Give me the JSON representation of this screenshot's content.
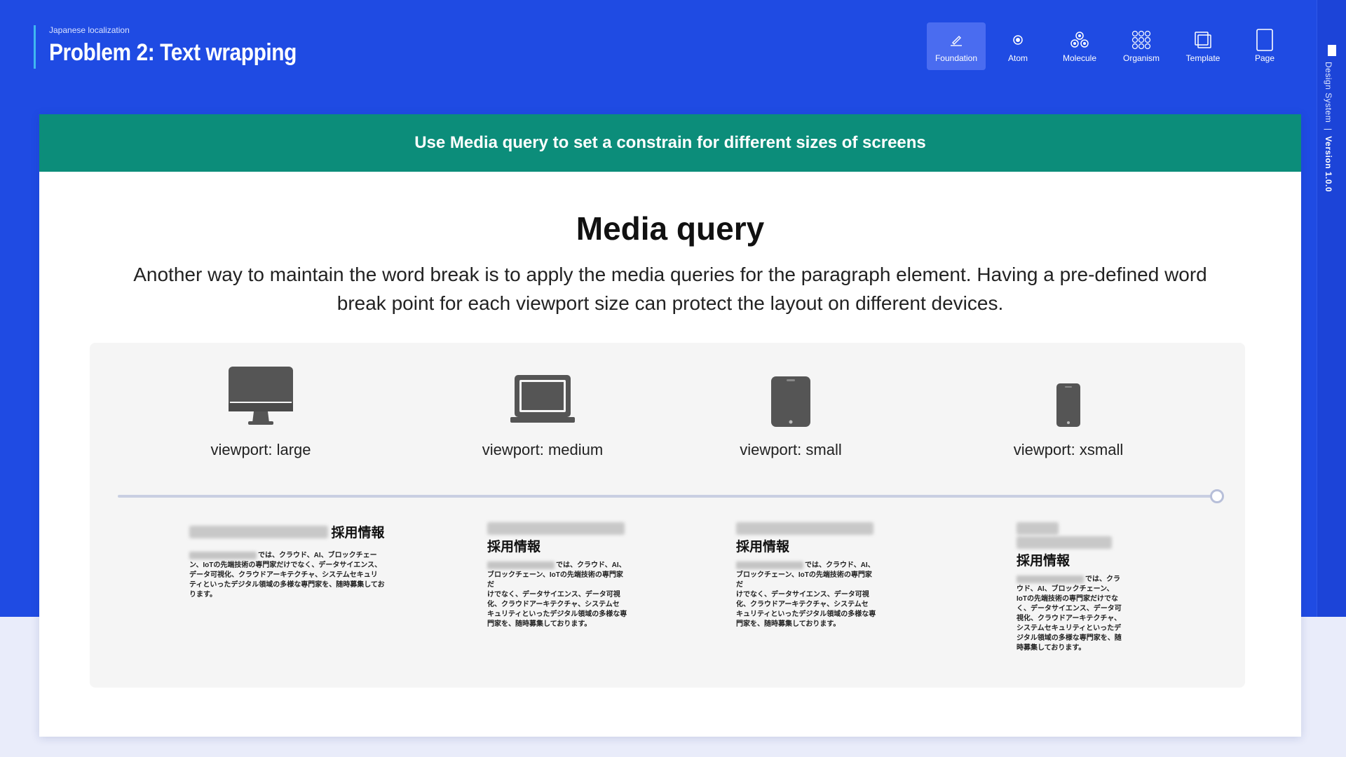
{
  "header": {
    "eyebrow": "Japanese localization",
    "title": "Problem 2: Text wrapping"
  },
  "nav": {
    "items": [
      {
        "label": "Foundation",
        "icon": "pencil-icon",
        "active": true
      },
      {
        "label": "Atom",
        "icon": "atom-icon",
        "active": false
      },
      {
        "label": "Molecule",
        "icon": "molecule-icon",
        "active": false
      },
      {
        "label": "Organism",
        "icon": "organism-icon",
        "active": false
      },
      {
        "label": "Template",
        "icon": "template-icon",
        "active": false
      },
      {
        "label": "Page",
        "icon": "page-icon",
        "active": false
      }
    ]
  },
  "siderail": {
    "label": "Design System",
    "separator": "|",
    "version": "Version 1.0.0"
  },
  "banner": {
    "text": "Use Media query to set a constrain for different sizes of screens"
  },
  "section": {
    "heading": "Media query",
    "lead": "Another way to maintain the word break is to apply the media queries for the paragraph element. Having a pre-defined word break point for each viewport size can protect the layout on different devices."
  },
  "viewports": [
    {
      "label": "viewport: large",
      "icon": "desktop-monitor-icon"
    },
    {
      "label": "viewport: medium",
      "icon": "laptop-icon"
    },
    {
      "label": "viewport: small",
      "icon": "tablet-icon"
    },
    {
      "label": "viewport: xsmall",
      "icon": "smartphone-icon"
    }
  ],
  "samples": {
    "title": "採用情報",
    "body_prefix": "では、",
    "body_lines_large": [
      "では、クラウド、AI、ブロックチェー",
      "ン、IoTの先端技術の専門家だけでなく、データサイエンス、",
      "データ可視化、クラウドアーキテクチャ、システムセキュリ",
      "ティといったデジタル領域の多様な専門家を、随時募集してお",
      "ります。"
    ],
    "body_lines_medium": [
      "では、クラウド、AI、",
      "ブロックチェーン、IoTの先端技術の専門家だ",
      "けでなく、データサイエンス、データ可視",
      "化、クラウドアーキテクチャ、システムセ",
      "キュリティといったデジタル領域の多様な専",
      "門家を、随時募集しております。"
    ],
    "body_lines_small": [
      "では、クラウド、AI、",
      "ブロックチェーン、IoTの先端技術の専門家だ",
      "けでなく、データサイエンス、データ可視",
      "化、クラウドアーキテクチャ、システムセ",
      "キュリティといったデジタル領域の多様な専",
      "門家を、随時募集しております。"
    ],
    "body_lines_xsmall": [
      "では、クラ",
      "ウド、AI、ブロックチェーン、",
      "IoTの先端技術の専門家だけでな",
      "く、データサイエンス、データ可",
      "視化、クラウドアーキテクチャ、",
      "システムセキュリティといったデ",
      "ジタル領域の多様な専門家を、随",
      "時募集しております。"
    ]
  },
  "colors": {
    "background": "#1f4be3",
    "banner": "#0c8d7a",
    "accent": "#3fb8f0",
    "icon_gray": "#555555"
  }
}
